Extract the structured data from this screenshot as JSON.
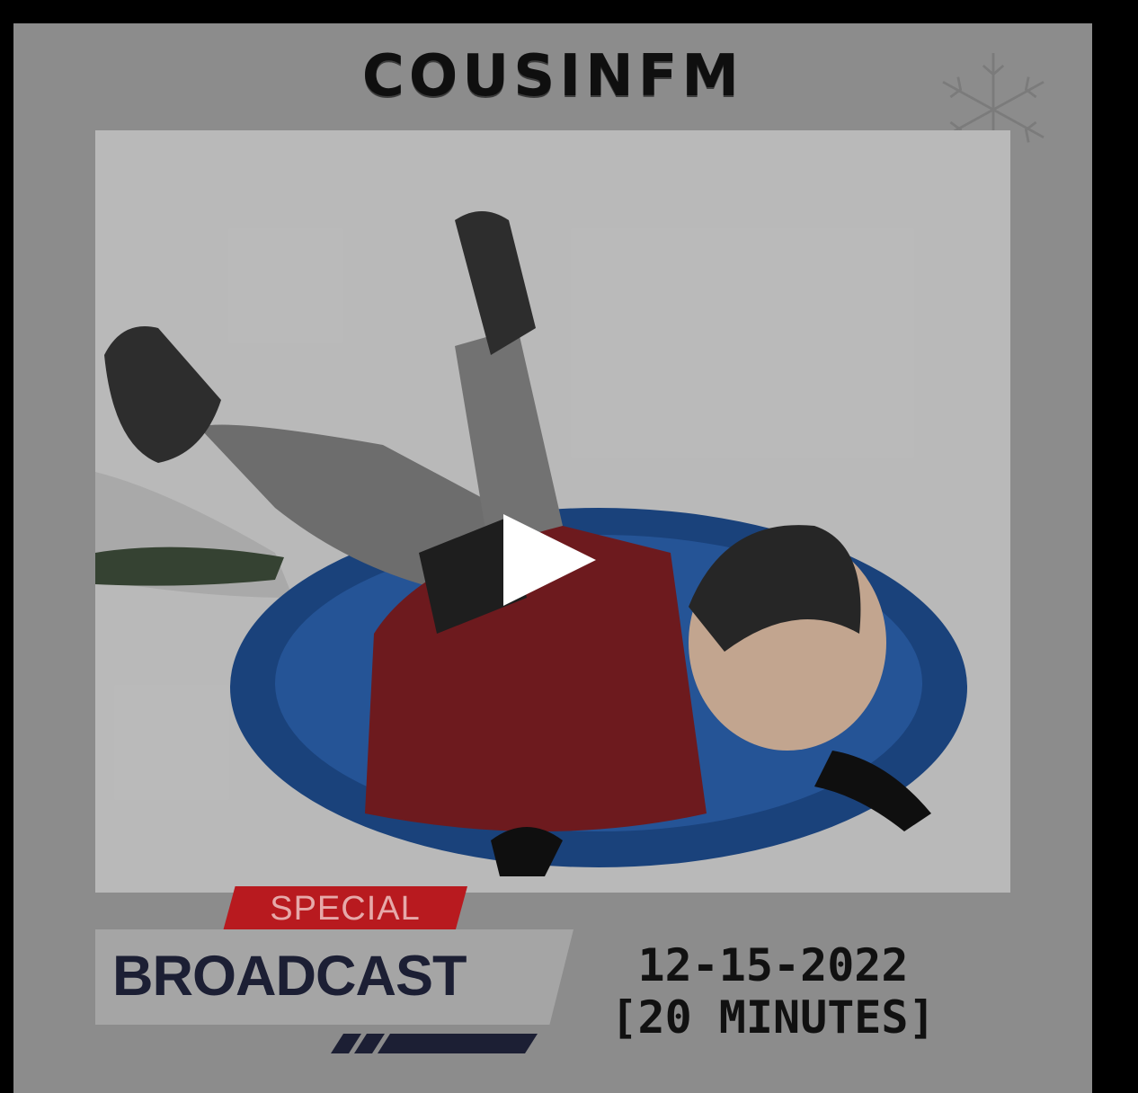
{
  "brand": "COUSINFM",
  "banner": {
    "special": "SPECIAL",
    "broadcast": "BROADCAST"
  },
  "date": "12-15-2022",
  "duration": "[20 MINUTES]",
  "icons": {
    "play": "play-icon",
    "decoration": "snowflake-icon"
  },
  "colors": {
    "accent_red": "#b81a1f",
    "navy": "#1c1f34"
  }
}
